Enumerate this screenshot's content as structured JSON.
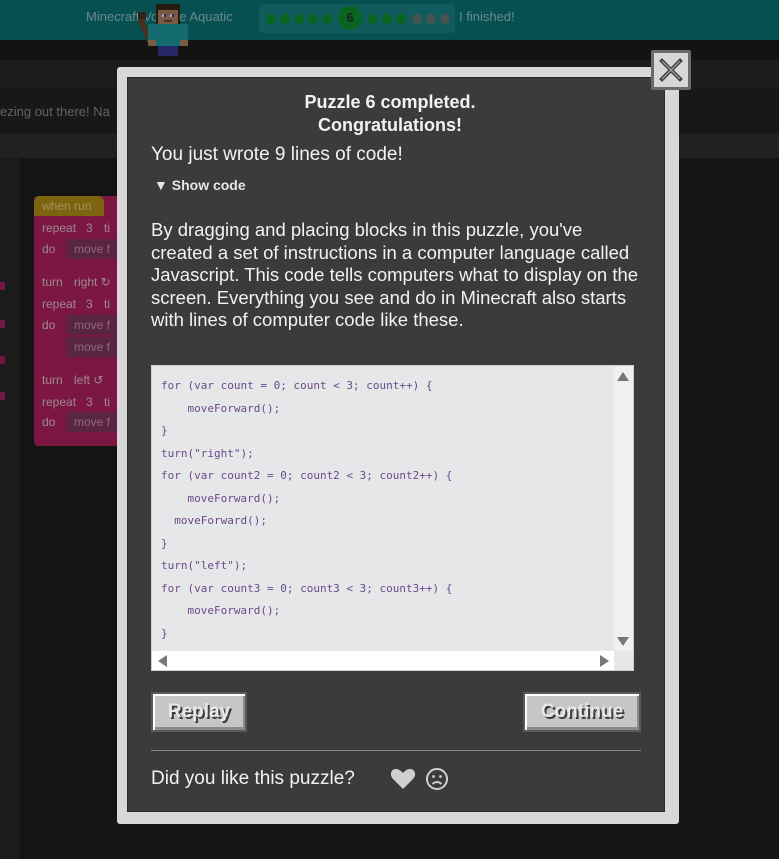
{
  "header": {
    "title": "Minecraft Voyage Aquatic",
    "current_level": "6",
    "finished_label": "I finished!"
  },
  "background": {
    "hint_text": "ezing out there! Na",
    "blocks": {
      "when_run": "when run",
      "repeat1": "repeat",
      "repeat1_count": "3",
      "repeat1_suffix": "ti",
      "do1": "do",
      "move1": "move f",
      "turn1": "turn",
      "turn1_dir": "right ↻",
      "repeat2": "repeat",
      "repeat2_count": "3",
      "repeat2_suffix": "ti",
      "do2": "do",
      "move2a": "move f",
      "move2b": "move f",
      "turn2": "turn",
      "turn2_dir": "left ↺",
      "repeat3": "repeat",
      "repeat3_count": "3",
      "repeat3_suffix": "ti",
      "do3": "do",
      "move3": "move f"
    }
  },
  "dialog": {
    "title_line1": "Puzzle 6 completed.",
    "title_line2": "Congratulations!",
    "lines_message": "You just wrote 9 lines of code!",
    "show_code_label": "▼ Show code",
    "explanation": "By dragging and placing blocks in this puzzle, you've created a set of instructions in a computer language called Javascript. This code tells computers what to display on the screen. Everything you see and do in Minecraft also starts with lines of computer code like these.",
    "code_lines": [
      "for (var count = 0; count < 3; count++) {",
      "    moveForward();",
      "}",
      "turn(\"right\");",
      "for (var count2 = 0; count2 < 3; count2++) {",
      "    moveForward();",
      "  moveForward();",
      "}",
      "turn(\"left\");",
      "for (var count3 = 0; count3 < 3; count3++) {",
      "    moveForward();",
      "}"
    ],
    "replay_label": "Replay",
    "continue_label": "Continue",
    "feedback_question": "Did you like this puzzle?"
  },
  "colors": {
    "header_bg": "#0b7b7f",
    "progress_done": "#0d9c31",
    "dialog_bg": "#3b3b3b",
    "code_text": "#6a4a8a",
    "block_pink": "#bf2469",
    "block_yellow": "#c49a17"
  },
  "icons": {
    "close": "close-x-icon",
    "like": "heart-icon",
    "dislike": "frown-face-icon"
  }
}
